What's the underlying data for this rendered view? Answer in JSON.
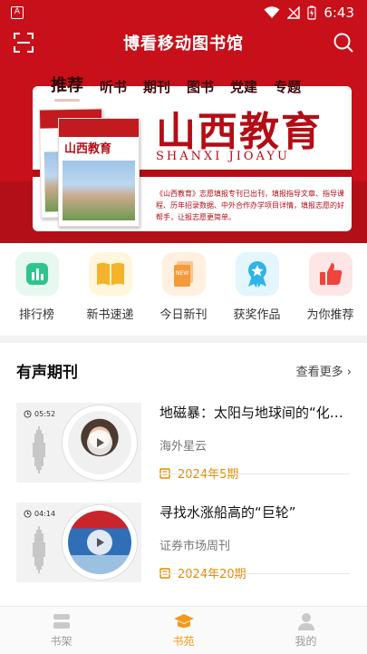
{
  "status": {
    "sim": "A",
    "time": "6:43"
  },
  "header": {
    "title": "博看移动图书馆"
  },
  "tabs": [
    {
      "label": "推荐",
      "active": true
    },
    {
      "label": "听书",
      "active": false
    },
    {
      "label": "期刊",
      "active": false
    },
    {
      "label": "图书",
      "active": false
    },
    {
      "label": "党建",
      "active": false
    },
    {
      "label": "专题",
      "active": false
    }
  ],
  "banner": {
    "title_cn": "山西教育",
    "title_en": "SHANXI   JIOAYU",
    "description": "《山西教育》志愿填报专刊已出刊，填报指导文章、指导课程、历年招录数据、中外合作办学项目详情，填报志愿的好帮手，让报志愿更简单。",
    "mag_name": "山西教育"
  },
  "quick": [
    {
      "label": "排行榜",
      "icon": "ranking-icon",
      "color": "#2fc48d"
    },
    {
      "label": "新书速递",
      "icon": "book-icon",
      "color": "#f3b32a"
    },
    {
      "label": "今日新刊",
      "icon": "new-magazine-icon",
      "color": "#f59a3b"
    },
    {
      "label": "获奖作品",
      "icon": "award-icon",
      "color": "#2fb3e8"
    },
    {
      "label": "为你推荐",
      "icon": "thumbs-up-icon",
      "color": "#f0433a"
    }
  ],
  "audio_section": {
    "title": "有声期刊",
    "more": "查看更多",
    "items": [
      {
        "duration": "05:52",
        "title": "地磁暴：太阳与地球间的“化学反应”",
        "source": "海外星云",
        "issue": "2024年5期"
      },
      {
        "duration": "04:14",
        "title": "寻找水涨船高的“巨轮”",
        "source": "证券市场周刊",
        "issue": "2024年20期"
      }
    ]
  },
  "bottom_nav": [
    {
      "label": "书架",
      "icon": "bookshelf-icon",
      "active": false
    },
    {
      "label": "书苑",
      "icon": "graduation-cap-icon",
      "active": true
    },
    {
      "label": "我的",
      "icon": "user-icon",
      "active": false
    }
  ]
}
